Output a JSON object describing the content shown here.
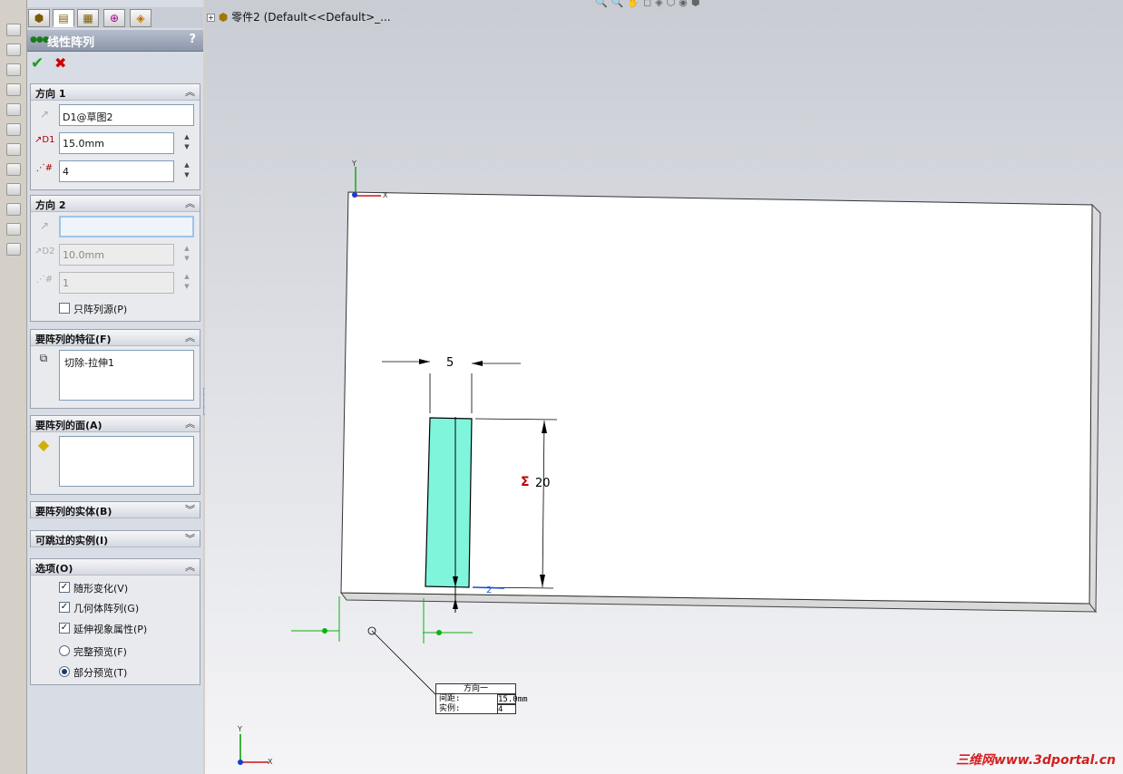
{
  "panel": {
    "title": "线性阵列",
    "help": "?",
    "ok_icon": "check-icon",
    "cancel_icon": "close-icon",
    "tabs": [
      "feature-manager-icon",
      "property-manager-icon",
      "configuration-manager-icon",
      "dimxpert-icon",
      "display-manager-icon"
    ],
    "direction1": {
      "header": "方向 1",
      "edge": "D1@草图2",
      "spacing": "15.0mm",
      "instances": "4"
    },
    "direction2": {
      "header": "方向 2",
      "edge": "",
      "spacing": "10.0mm",
      "instances": "1",
      "seed_only_label": "只阵列源(P)"
    },
    "features": {
      "header": "要阵列的特征(F)",
      "item": "切除-拉伸1"
    },
    "faces": {
      "header": "要阵列的面(A)"
    },
    "bodies": {
      "header": "要阵列的实体(B)"
    },
    "skip": {
      "header": "可跳过的实例(I)"
    },
    "options": {
      "header": "选项(O)",
      "vary_sketch": "随形变化(V)",
      "geometry_pattern": "几何体阵列(G)",
      "propagate_visual": "延伸视象属性(P)",
      "full_preview": "完整预览(F)",
      "partial_preview": "部分预览(T)"
    }
  },
  "tree": {
    "root": "零件2  (Default<<Default>_..."
  },
  "viewport": {
    "dim_width": "5",
    "dim_height": "20",
    "sigma": "Σ",
    "triad_x": "X",
    "triad_y": "Y",
    "callout": {
      "title": "方向一",
      "spacing_label": "间距:",
      "spacing_value": "15.0mm",
      "instances_label": "实例:",
      "instances_value": "4"
    }
  },
  "watermark": "三维网www.3dportal.cn",
  "colors": {
    "accent": "#7ff5dc",
    "title_bar": "#8d97aa",
    "panel_bg": "#d8dce4"
  }
}
